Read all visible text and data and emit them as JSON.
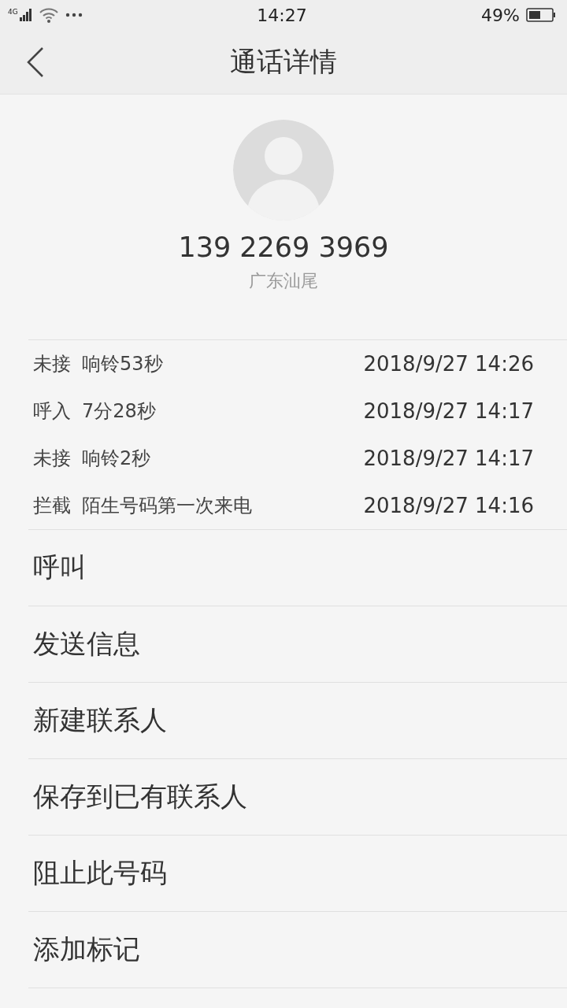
{
  "status_bar": {
    "network": "4G",
    "time": "14:27",
    "battery": "49%"
  },
  "header": {
    "title": "通话详情"
  },
  "contact": {
    "number": "139 2269 3969",
    "location": "广东汕尾"
  },
  "call_log": [
    {
      "type": "未接",
      "detail": "响铃53秒",
      "time": "2018/9/27 14:26"
    },
    {
      "type": "呼入",
      "detail": "7分28秒",
      "time": "2018/9/27 14:17"
    },
    {
      "type": "未接",
      "detail": "响铃2秒",
      "time": "2018/9/27 14:17"
    },
    {
      "type": "拦截",
      "detail": "陌生号码第一次来电",
      "time": "2018/9/27 14:16"
    }
  ],
  "actions": [
    "呼叫",
    "发送信息",
    "新建联系人",
    "保存到已有联系人",
    "阻止此号码",
    "添加标记"
  ]
}
